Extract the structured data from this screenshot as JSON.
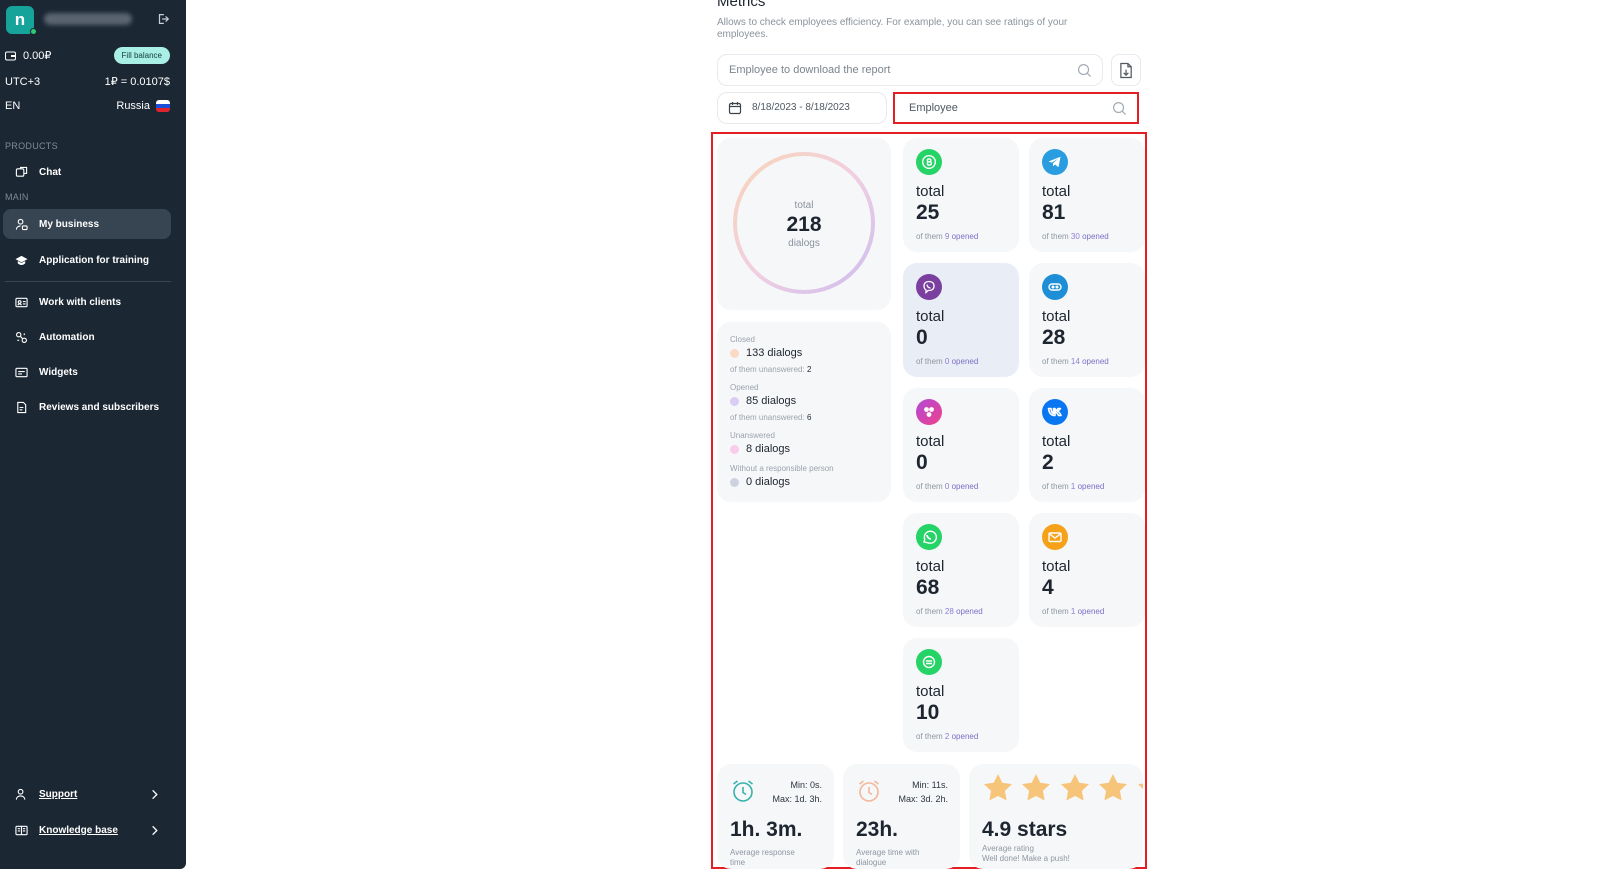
{
  "sidebar": {
    "logo_letter": "n",
    "balance": "0.00₽",
    "fill_balance": "Fill balance",
    "timezone": "UTC+3",
    "rate": "1₽ = 0.0107$",
    "language": "EN",
    "country": "Russia",
    "section_products": "PRODUCTS",
    "section_main": "MAIN",
    "items": [
      {
        "label": "Chat"
      },
      {
        "label": "My business"
      },
      {
        "label": "Application for training"
      },
      {
        "label": "Work with clients"
      },
      {
        "label": "Automation"
      },
      {
        "label": "Widgets"
      },
      {
        "label": "Reviews and subscribers"
      }
    ],
    "support": "Support",
    "knowledge": "Knowledge base"
  },
  "header": {
    "title": "Metrics",
    "description": "Allows to check employees efficiency. For example, you can see ratings of your employees."
  },
  "filters": {
    "report_placeholder": "Employee to download the report",
    "date_range": "8/18/2023 - 8/18/2023",
    "employee_placeholder": "Employee"
  },
  "donut": {
    "top": "total",
    "value": "218",
    "bottom": "dialogs"
  },
  "stats": {
    "closed_label": "Closed",
    "closed_value": "133 dialogs",
    "closed_sub": "of them unanswered:",
    "closed_sub_n": "2",
    "opened_label": "Opened",
    "opened_value": "85 dialogs",
    "opened_sub": "of them unanswered:",
    "opened_sub_n": "6",
    "unanswered_label": "Unanswered",
    "unanswered_value": "8 dialogs",
    "noresp_label": "Without a responsible person",
    "noresp_value": "0 dialogs"
  },
  "channels": [
    {
      "total_label": "total",
      "total": "25",
      "pre": "of them",
      "opened": "9",
      "post": "opened",
      "icon": "whatsapp-business-icon",
      "color": "#25d366"
    },
    {
      "total_label": "total",
      "total": "81",
      "pre": "of them",
      "opened": "30",
      "post": "opened",
      "icon": "telegram-icon",
      "color": "#2a9de0"
    },
    {
      "total_label": "total",
      "total": "0",
      "pre": "of them",
      "opened": "0",
      "post": "opened",
      "icon": "viber-icon",
      "color": "#7b3fa0"
    },
    {
      "total_label": "total",
      "total": "28",
      "pre": "of them",
      "opened": "14",
      "post": "opened",
      "icon": "chat-bot-icon",
      "color": "#1e8fd6"
    },
    {
      "total_label": "total",
      "total": "0",
      "pre": "of them",
      "opened": "0",
      "post": "opened",
      "icon": "instagram-icon",
      "color": "#e0409a"
    },
    {
      "total_label": "total",
      "total": "2",
      "pre": "of them",
      "opened": "1",
      "post": "opened",
      "icon": "vk-icon",
      "color": "#0a77f2"
    },
    {
      "total_label": "total",
      "total": "68",
      "pre": "of them",
      "opened": "28",
      "post": "opened",
      "icon": "whatsapp-icon",
      "color": "#25d366"
    },
    {
      "total_label": "total",
      "total": "4",
      "pre": "of them",
      "opened": "1",
      "post": "opened",
      "icon": "email-icon",
      "color": "#f5a11a"
    },
    {
      "total_label": "total",
      "total": "10",
      "pre": "of them",
      "opened": "2",
      "post": "opened",
      "icon": "avito-chat-icon",
      "color": "#25d366"
    }
  ],
  "bottom": {
    "resp_min": "Min: 0s.",
    "resp_max": "Max: 1d. 3h.",
    "resp_value": "1h. 3m.",
    "resp_label": "Average response time",
    "dlg_min": "Min: 11s.",
    "dlg_max": "Max: 3d. 2h.",
    "dlg_value": "23h.",
    "dlg_label": "Average time with dialogue",
    "rating_value": "4.9 stars",
    "rating_label": "Average rating",
    "rating_note": "Well done! Make a push!",
    "rating_stars": 5
  },
  "colors": {
    "sidebar_bg": "#1b2733",
    "accent": "#16a39a",
    "highlight_frame": "#e31e24",
    "star": "#f7c57a"
  }
}
